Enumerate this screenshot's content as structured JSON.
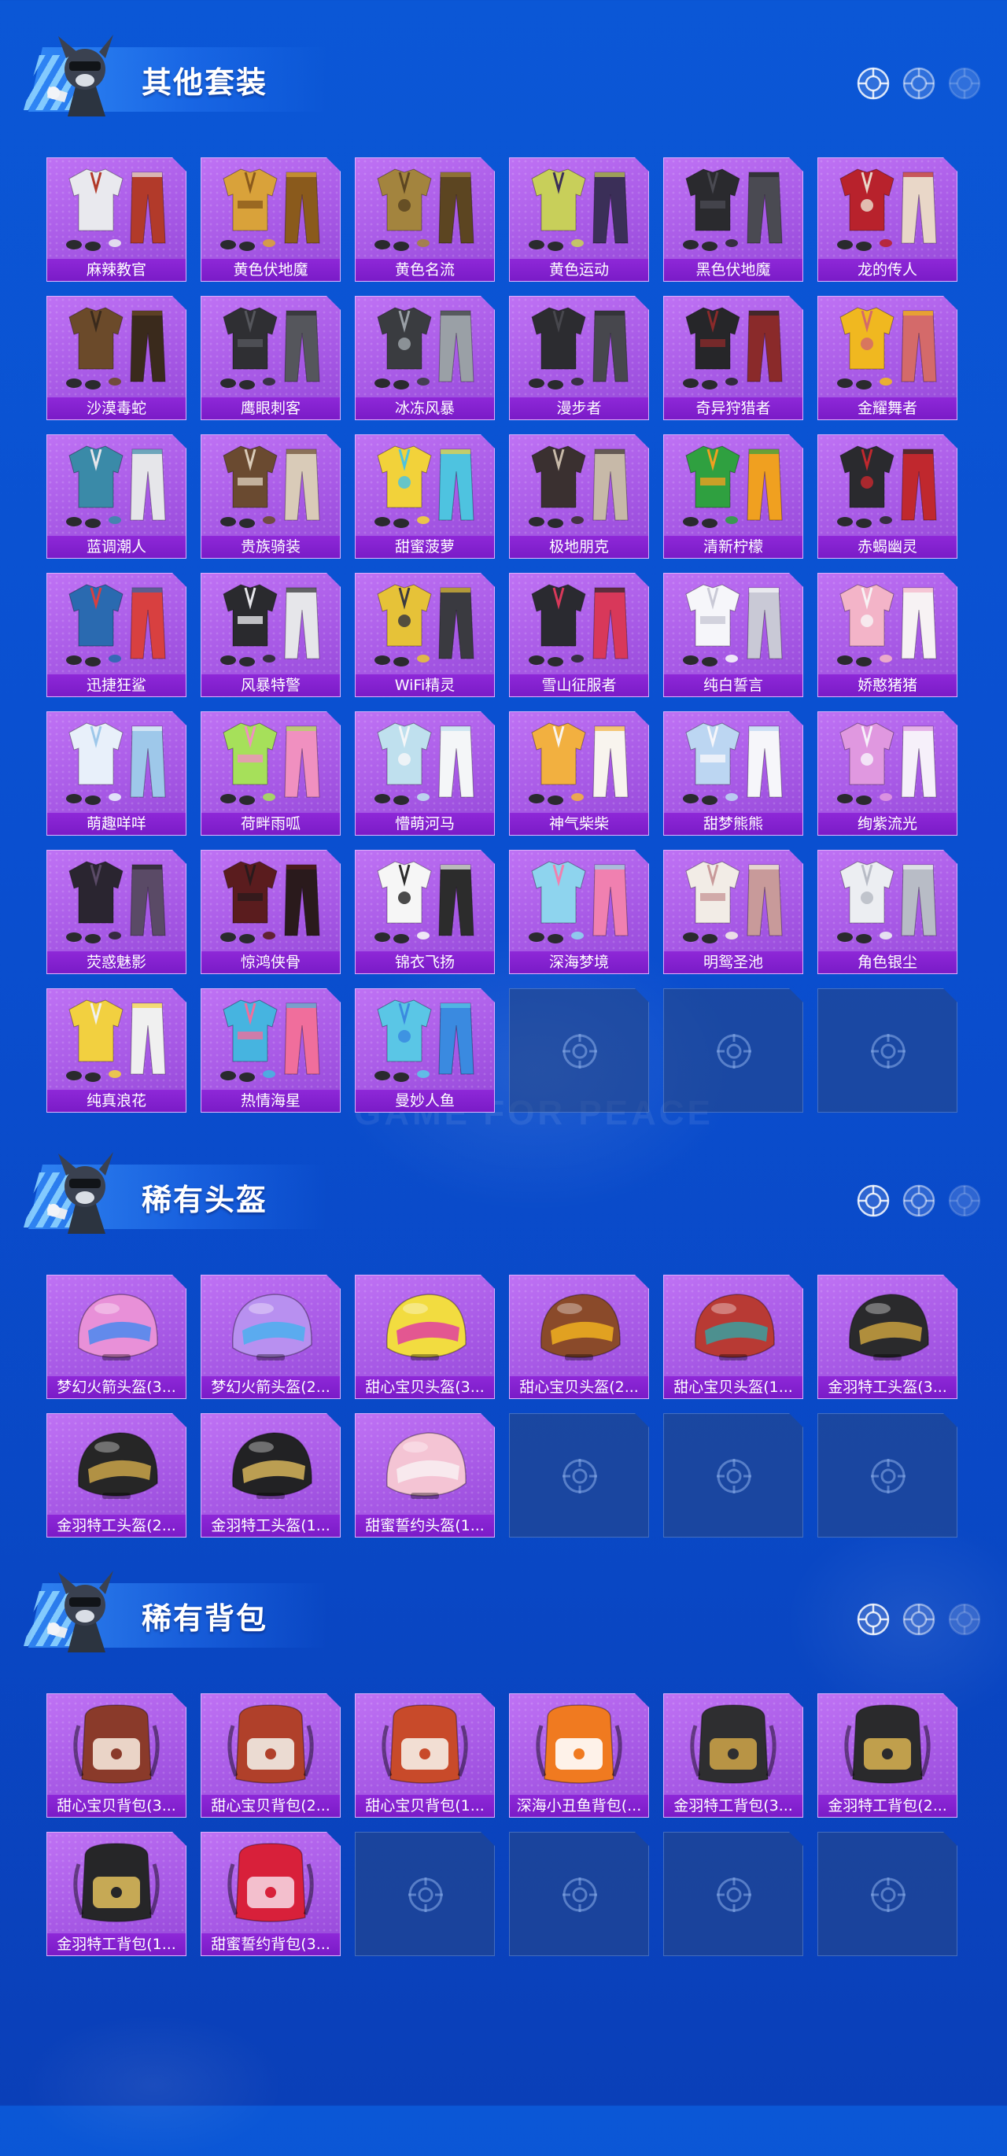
{
  "watermark": "GAME FOR PEACE",
  "sections": [
    {
      "title": "其他套装",
      "items": [
        {
          "name": "麻辣教官",
          "kind": "outfit",
          "c1": "#e9e9ee",
          "c2": "#b23a2a"
        },
        {
          "name": "黄色伏地魔",
          "kind": "outfit",
          "c1": "#d9a23a",
          "c2": "#8a5a1c"
        },
        {
          "name": "黄色名流",
          "kind": "outfit",
          "c1": "#a3843e",
          "c2": "#5c4521"
        },
        {
          "name": "黄色运动",
          "kind": "outfit",
          "c1": "#c8cf5a",
          "c2": "#3b2f58"
        },
        {
          "name": "黑色伏地魔",
          "kind": "outfit",
          "c1": "#2a2a2e",
          "c2": "#4a4a52"
        },
        {
          "name": "龙的传人",
          "kind": "outfit",
          "c1": "#b8222c",
          "c2": "#e9d7c8"
        },
        {
          "name": "沙漠毒蛇",
          "kind": "outfit",
          "c1": "#6b4a2a",
          "c2": "#3a2a1c"
        },
        {
          "name": "鹰眼刺客",
          "kind": "outfit",
          "c1": "#2f2f33",
          "c2": "#55565c"
        },
        {
          "name": "冰冻风暴",
          "kind": "outfit",
          "c1": "#3a3c40",
          "c2": "#9aa0a6"
        },
        {
          "name": "漫步者",
          "kind": "outfit",
          "c1": "#2c2c30",
          "c2": "#47474d"
        },
        {
          "name": "奇异狩猎者",
          "kind": "outfit",
          "c1": "#262629",
          "c2": "#8a2a2a"
        },
        {
          "name": "金耀舞者",
          "kind": "outfit",
          "c1": "#f0b820",
          "c2": "#d46a6a"
        },
        {
          "name": "蓝调潮人",
          "kind": "outfit",
          "c1": "#3a8aa8",
          "c2": "#e6e6ea"
        },
        {
          "name": "贵族骑装",
          "kind": "outfit",
          "c1": "#6a4a30",
          "c2": "#d9cbb8"
        },
        {
          "name": "甜蜜菠萝",
          "kind": "outfit",
          "c1": "#f2d23a",
          "c2": "#4ec3e0"
        },
        {
          "name": "极地朋克",
          "kind": "outfit",
          "c1": "#3a3030",
          "c2": "#c7b9a8"
        },
        {
          "name": "清新柠檬",
          "kind": "outfit",
          "c1": "#2fa040",
          "c2": "#f0a020"
        },
        {
          "name": "赤蝎幽灵",
          "kind": "outfit",
          "c1": "#2a2a2e",
          "c2": "#c0282e"
        },
        {
          "name": "迅捷狂鲨",
          "kind": "outfit",
          "c1": "#2a6ab0",
          "c2": "#d84040"
        },
        {
          "name": "风暴特警",
          "kind": "outfit",
          "c1": "#2a2a2e",
          "c2": "#e6e6ea"
        },
        {
          "name": "WiFi精灵",
          "kind": "outfit",
          "c1": "#e6c238",
          "c2": "#3a3a40"
        },
        {
          "name": "雪山征服者",
          "kind": "outfit",
          "c1": "#2a2a30",
          "c2": "#d8385a"
        },
        {
          "name": "纯白誓言",
          "kind": "outfit",
          "c1": "#f6f6fa",
          "c2": "#c9c9d6"
        },
        {
          "name": "娇憨猪猪",
          "kind": "outfit",
          "c1": "#f3b4c8",
          "c2": "#f7f2f4"
        },
        {
          "name": "萌趣咩咩",
          "kind": "outfit",
          "c1": "#e8f0fa",
          "c2": "#9ec8ea"
        },
        {
          "name": "荷畔雨呱",
          "kind": "outfit",
          "c1": "#a6e05a",
          "c2": "#f090c0"
        },
        {
          "name": "懵萌河马",
          "kind": "outfit",
          "c1": "#bfe0ee",
          "c2": "#f4f6f8"
        },
        {
          "name": "神气柴柴",
          "kind": "outfit",
          "c1": "#f2b040",
          "c2": "#f8f4ee"
        },
        {
          "name": "甜梦熊熊",
          "kind": "outfit",
          "c1": "#bcd6f2",
          "c2": "#f6f6fa"
        },
        {
          "name": "绚紫流光",
          "kind": "outfit",
          "c1": "#e098e0",
          "c2": "#f6f0fa"
        },
        {
          "name": "荧惑魅影",
          "kind": "outfit",
          "c1": "#2a2530",
          "c2": "#5a4a66"
        },
        {
          "name": "惊鸿侠骨",
          "kind": "outfit",
          "c1": "#5a1c1e",
          "c2": "#2a1a1c"
        },
        {
          "name": "锦衣飞扬",
          "kind": "outfit",
          "c1": "#f6f6f6",
          "c2": "#2c2c2c"
        },
        {
          "name": "深海梦境",
          "kind": "outfit",
          "c1": "#8ed4ee",
          "c2": "#f080b0"
        },
        {
          "name": "明鸳圣池",
          "kind": "outfit",
          "c1": "#f2ece6",
          "c2": "#c89a9a"
        },
        {
          "name": "角色银尘",
          "kind": "outfit",
          "c1": "#eceef2",
          "c2": "#b8bcc6"
        },
        {
          "name": "纯真浪花",
          "kind": "outfit",
          "c1": "#f2d040",
          "c2": "#f0f0f0"
        },
        {
          "name": "热情海星",
          "kind": "outfit",
          "c1": "#46b4e0",
          "c2": "#f06e9c"
        },
        {
          "name": "曼妙人鱼",
          "kind": "outfit",
          "c1": "#5ac6e6",
          "c2": "#3a8ae0"
        }
      ],
      "empty_slots": 3
    },
    {
      "title": "稀有头盔",
      "items": [
        {
          "name": "梦幻火箭头盔(3...",
          "kind": "helmet",
          "c1": "#e890d8",
          "c2": "#4a8aee"
        },
        {
          "name": "梦幻火箭头盔(2...",
          "kind": "helmet",
          "c1": "#b890f0",
          "c2": "#4ab0ee"
        },
        {
          "name": "甜心宝贝头盔(3...",
          "kind": "helmet",
          "c1": "#f2dc40",
          "c2": "#e040a0"
        },
        {
          "name": "甜心宝贝头盔(2...",
          "kind": "helmet",
          "c1": "#8a4a2a",
          "c2": "#f0b020"
        },
        {
          "name": "甜心宝贝头盔(1...",
          "kind": "helmet",
          "c1": "#b83a34",
          "c2": "#3aa0a0"
        },
        {
          "name": "金羽特工头盔(3...",
          "kind": "helmet",
          "c1": "#2a2a2c",
          "c2": "#c8a040"
        },
        {
          "name": "金羽特工头盔(2...",
          "kind": "helmet",
          "c1": "#262626",
          "c2": "#caa44a"
        },
        {
          "name": "金羽特工头盔(1...",
          "kind": "helmet",
          "c1": "#222224",
          "c2": "#d6b45a"
        },
        {
          "name": "甜蜜誓约头盔(1...",
          "kind": "helmet",
          "c1": "#f4c4d4",
          "c2": "#f8f0f2"
        }
      ],
      "empty_slots": 3
    },
    {
      "title": "稀有背包",
      "items": [
        {
          "name": "甜心宝贝背包(3...",
          "kind": "backpack",
          "c1": "#8a3a2a",
          "c2": "#f4e6d8"
        },
        {
          "name": "甜心宝贝背包(2...",
          "kind": "backpack",
          "c1": "#b0402a",
          "c2": "#f2ece4"
        },
        {
          "name": "甜心宝贝背包(1...",
          "kind": "backpack",
          "c1": "#c84a2a",
          "c2": "#f6eee6"
        },
        {
          "name": "深海小丑鱼背包(...",
          "kind": "backpack",
          "c1": "#f07a20",
          "c2": "#ffffff"
        },
        {
          "name": "金羽特工背包(3...",
          "kind": "backpack",
          "c1": "#2e2e30",
          "c2": "#c8a048"
        },
        {
          "name": "金羽特工背包(2...",
          "kind": "backpack",
          "c1": "#2a2a2c",
          "c2": "#d0ac50"
        },
        {
          "name": "金羽特工背包(1...",
          "kind": "backpack",
          "c1": "#262628",
          "c2": "#d8b85a"
        },
        {
          "name": "甜蜜誓约背包(3...",
          "kind": "backpack",
          "c1": "#d8203a",
          "c2": "#f6d0de"
        }
      ],
      "empty_slots": 4
    }
  ]
}
